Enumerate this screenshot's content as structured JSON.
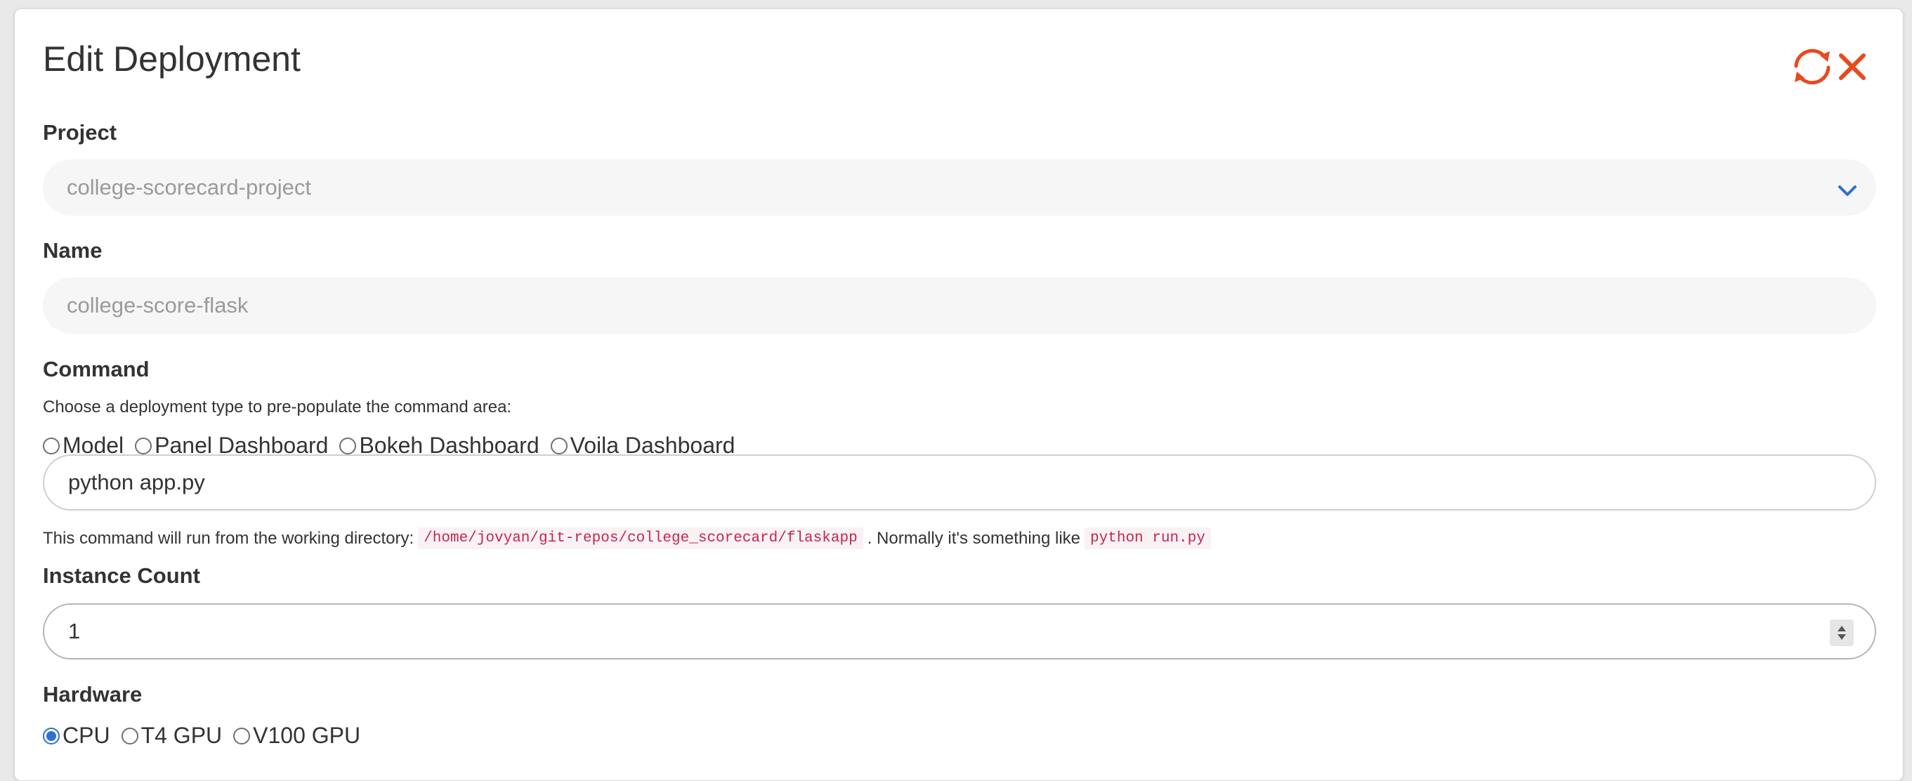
{
  "dialog": {
    "title": "Edit Deployment",
    "icons": {
      "refresh": "refresh-icon",
      "close": "close-icon"
    },
    "accent_color": "#e8491d"
  },
  "project": {
    "label": "Project",
    "value": "college-scorecard-project"
  },
  "name": {
    "label": "Name",
    "value": "college-score-flask"
  },
  "command": {
    "label": "Command",
    "help": "Choose a deployment type to pre-populate the command area:",
    "types": [
      "Model",
      "Panel Dashboard",
      "Bokeh Dashboard",
      "Voila Dashboard"
    ],
    "value": "python app.py",
    "hint_prefix": "This command will run from the working directory:",
    "working_dir": "/home/jovyan/git-repos/college_scorecard/flaskapp",
    "hint_middle": ". Normally it's something like",
    "example": "python run.py"
  },
  "instance_count": {
    "label": "Instance Count",
    "value": "1"
  },
  "hardware": {
    "label": "Hardware",
    "options": [
      "CPU",
      "T4 GPU",
      "V100 GPU"
    ],
    "selected": "CPU"
  }
}
